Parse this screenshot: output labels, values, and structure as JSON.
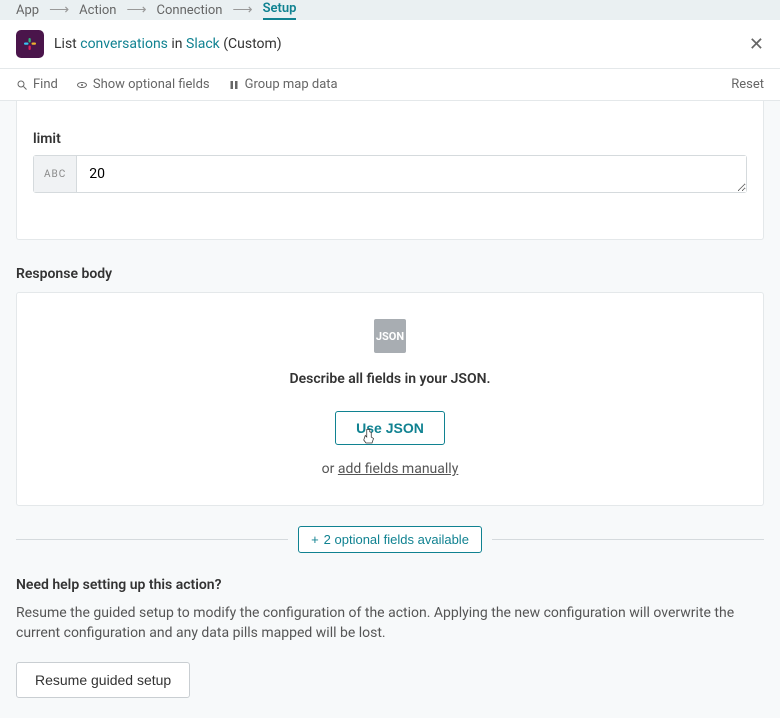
{
  "breadcrumb": {
    "items": [
      "App",
      "Action",
      "Connection",
      "Setup"
    ],
    "active_index": 3
  },
  "header": {
    "prefix": "List ",
    "link1": "conversations",
    "mid": " in ",
    "link2": "Slack",
    "suffix": " (Custom)"
  },
  "toolbar": {
    "find": "Find",
    "show_optional": "Show optional fields",
    "group_map": "Group map data",
    "reset": "Reset"
  },
  "limit_field": {
    "label": "limit",
    "prefix": "ABC",
    "value": "20"
  },
  "response": {
    "section": "Response body",
    "badge": "JSON",
    "desc": "Describe all fields in your JSON.",
    "button": "Use JSON",
    "or": "or ",
    "add_manually": "add fields manually"
  },
  "optional": {
    "label": "2 optional fields available"
  },
  "help": {
    "title": "Need help setting up this action?",
    "body": "Resume the guided setup to modify the configuration of the action. Applying the new configuration will overwrite the current configuration and any data pills mapped will be lost.",
    "button": "Resume guided setup"
  }
}
